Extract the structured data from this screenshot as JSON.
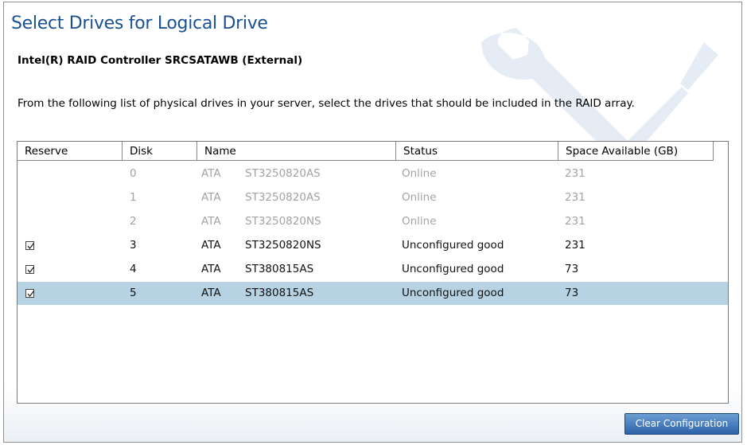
{
  "page": {
    "title": "Select Drives for Logical Drive",
    "controller": "Intel(R) RAID Controller SRCSATAWB (External)",
    "description": "From the following list of physical drives in your server, select the drives that should be included in the RAID array."
  },
  "table": {
    "headers": {
      "reserve": "Reserve",
      "disk": "Disk",
      "name": "Name",
      "status": "Status",
      "space": "Space Available (GB)"
    },
    "rows": [
      {
        "reserve": false,
        "disk": "0",
        "vendor": "ATA",
        "model": "ST3250820AS",
        "status": "Online",
        "space": "231",
        "state": "disabled"
      },
      {
        "reserve": false,
        "disk": "1",
        "vendor": "ATA",
        "model": "ST3250820AS",
        "status": "Online",
        "space": "231",
        "state": "disabled"
      },
      {
        "reserve": false,
        "disk": "2",
        "vendor": "ATA",
        "model": "ST3250820NS",
        "status": "Online",
        "space": "231",
        "state": "disabled"
      },
      {
        "reserve": true,
        "disk": "3",
        "vendor": "ATA",
        "model": "ST3250820NS",
        "status": "Unconfigured good",
        "space": "231",
        "state": "enabled"
      },
      {
        "reserve": true,
        "disk": "4",
        "vendor": "ATA",
        "model": "ST380815AS",
        "status": "Unconfigured good",
        "space": "73",
        "state": "enabled"
      },
      {
        "reserve": true,
        "disk": "5",
        "vendor": "ATA",
        "model": "ST380815AS",
        "status": "Unconfigured good",
        "space": "73",
        "state": "selected"
      }
    ]
  },
  "actions": {
    "clear_configuration": "Clear Configuration"
  },
  "colors": {
    "title": "#1a5096",
    "selected_row": "#b7d3e3",
    "button": "#2b62a8"
  },
  "icons": {
    "watermark": "wrench-screwdriver-icon",
    "checkbox": "checkmark-icon"
  }
}
